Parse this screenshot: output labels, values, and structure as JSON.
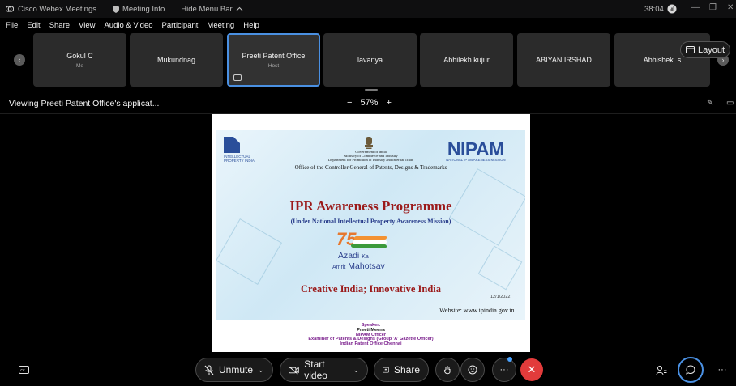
{
  "titlebar": {
    "app_name": "Cisco Webex Meetings",
    "meeting_info": "Meeting Info",
    "hide_menu": "Hide Menu Bar",
    "timer": "38:04",
    "minimize": "—",
    "restore": "❐",
    "close": "✕"
  },
  "menubar": {
    "items": [
      "File",
      "Edit",
      "Share",
      "View",
      "Audio & Video",
      "Participant",
      "Meeting",
      "Help"
    ]
  },
  "participants": [
    {
      "name": "Gokul C",
      "sub": "Me"
    },
    {
      "name": "Mukundnag",
      "sub": ""
    },
    {
      "name": "Preeti Patent Office",
      "sub": "Host"
    },
    {
      "name": "lavanya",
      "sub": ""
    },
    {
      "name": "Abhilekh kujur",
      "sub": ""
    },
    {
      "name": "ABIYAN IRSHAD",
      "sub": ""
    },
    {
      "name": "Abhishek .s",
      "sub": ""
    }
  ],
  "layout_label": "Layout",
  "viewbar": {
    "title": "Viewing Preeti Patent Office's applicat...",
    "zoom_minus": "−",
    "zoom_value": "57%",
    "zoom_plus": "+"
  },
  "slide": {
    "ipindia_text": "INTELLECTUAL PROPERTY INDIA",
    "govt_line1": "Government of India",
    "govt_line2": "Ministry of Commerce and Industry",
    "govt_line3": "Department for Promotion of Industry and Internal Trade",
    "office": "Office of the Controller General of Patents, Designs & Trademarks",
    "nipam": "NIPAM",
    "nipam_sub": "NATIONAL IP AWARENESS MISSION",
    "title": "IPR Awareness Programme",
    "subtitle": "(Under National Intellectual Property Awareness Mission)",
    "azadi_seventy": "75",
    "azadi_word": "Azadi",
    "azadi_ka": "Ka",
    "azadi_amrit": "Amrit",
    "azadi_mahotsav": "Mahotsav",
    "tagline": "Creative India; Innovative India",
    "date": "12/1/2022",
    "website": "Website: www.ipindia.gov.in"
  },
  "speaker": {
    "label": "Speaker:",
    "name": "Preeti Meena",
    "role": "NIPAM Officer",
    "designation": "Examiner of Patents & Designs (Group 'A' Gazette Officer)",
    "office": "Indian Patent Office Chennai"
  },
  "controls": {
    "unmute": "Unmute",
    "start_video": "Start video",
    "share": "Share"
  },
  "colors": {
    "accent_blue": "#4a90e2",
    "leave_red": "#e23b3b",
    "ipr_red": "#9b1b1b",
    "nipam_blue": "#2a4e9a"
  }
}
